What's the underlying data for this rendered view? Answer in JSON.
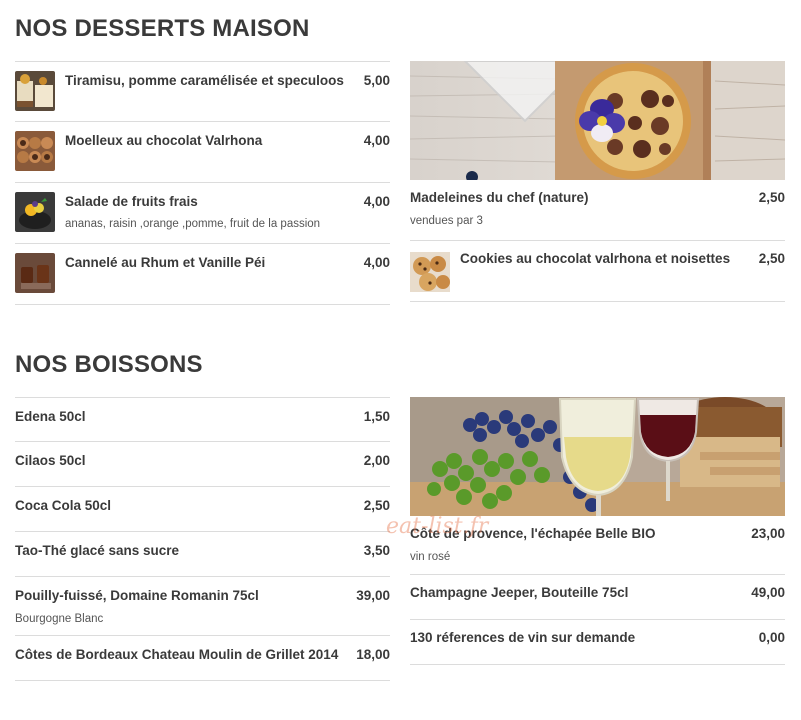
{
  "desserts": {
    "title": "NOS DESSERTS MAISON",
    "left_items": [
      {
        "name": "Tiramisu, pomme caramélisée et speculoos",
        "price": "5,00",
        "desc": "",
        "icon": "tiramisu-photo"
      },
      {
        "name": "Moelleux au chocolat Valrhona",
        "price": "4,00",
        "desc": "",
        "icon": "chocolate-cake-photo"
      },
      {
        "name": "Salade de fruits frais",
        "price": "4,00",
        "desc": "ananas, raisin ,orange ,pomme, fruit de la passion",
        "icon": "fruit-salad-photo"
      },
      {
        "name": "Cannelé au Rhum et Vanille Péi",
        "price": "4,00",
        "desc": "",
        "icon": "canele-photo"
      }
    ],
    "right_items": [
      {
        "name": "Madeleines du chef (nature)",
        "price": "2,50",
        "desc": "vendues par 3"
      },
      {
        "name": "Cookies au chocolat valrhona et noisettes",
        "price": "2,50",
        "desc": "",
        "icon": "cookies-photo"
      }
    ]
  },
  "drinks": {
    "title": "NOS BOISSONS",
    "left_items": [
      {
        "name": "Edena 50cl",
        "price": "1,50",
        "desc": ""
      },
      {
        "name": "Cilaos 50cl",
        "price": "2,00",
        "desc": ""
      },
      {
        "name": "Coca Cola 50cl",
        "price": "2,50",
        "desc": ""
      },
      {
        "name": "Tao-Thé glacé sans sucre",
        "price": "3,50",
        "desc": ""
      },
      {
        "name": "Pouilly-fuissé, Domaine Romanin 75cl",
        "price": "39,00",
        "desc": "Bourgogne Blanc"
      },
      {
        "name": "Côtes de Bordeaux Chateau Moulin de Grillet 2014",
        "price": "18,00",
        "desc": ""
      }
    ],
    "right_items": [
      {
        "name": "Côte de provence, l'échapée Belle BIO",
        "price": "23,00",
        "desc": "vin rosé"
      },
      {
        "name": "Champagne Jeeper, Bouteille 75cl",
        "price": "49,00",
        "desc": ""
      },
      {
        "name": "130 réferences de vin sur demande",
        "price": "0,00",
        "desc": ""
      }
    ]
  },
  "watermark": "eat-list.fr",
  "colors": {
    "text": "#3a3a3a",
    "divider": "#dcdcdc",
    "watermark": "#e67850"
  }
}
